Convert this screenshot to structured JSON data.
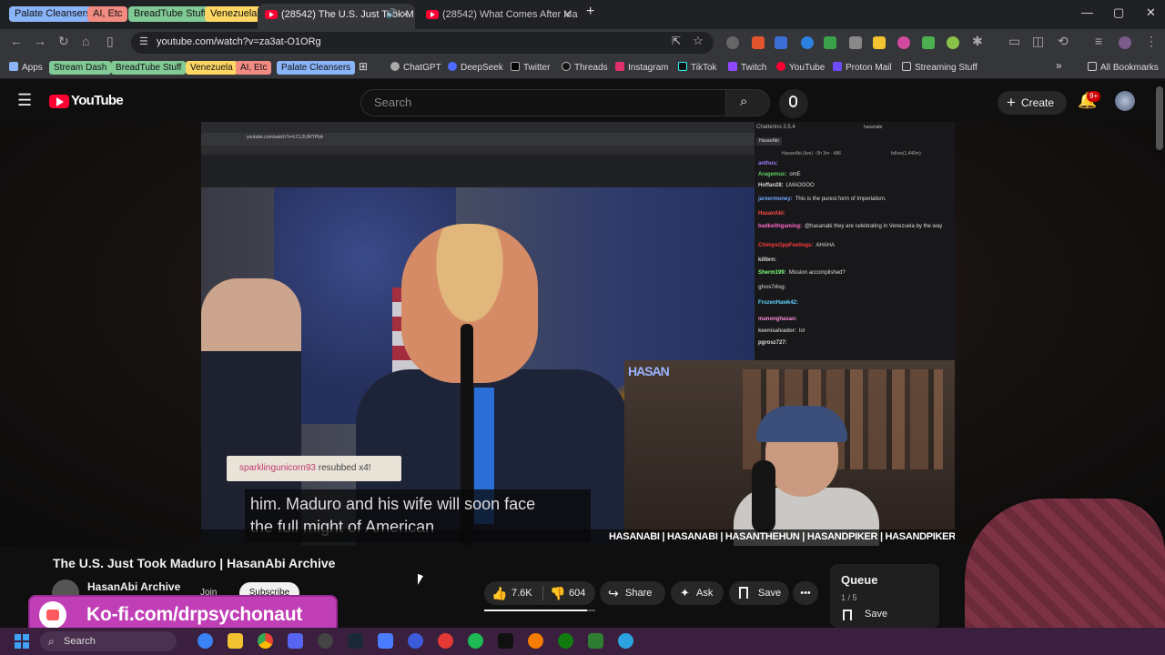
{
  "browser": {
    "tab_groups": [
      {
        "label": "Palate Cleansers",
        "color": "#8ab4f8"
      },
      {
        "label": "AI, Etc",
        "color": "#f28b82"
      },
      {
        "label": "BreadTube Stuff",
        "color": "#81c995"
      },
      {
        "label": "Venezuela",
        "color": "#fdd663"
      }
    ],
    "tabs": [
      {
        "title": "(28542) The U.S. Just Took M",
        "active": true
      },
      {
        "title": "(28542) What Comes After Mad",
        "active": false
      }
    ],
    "url": "youtube.com/watch?v=za3at-O1ORg",
    "bookmarks": {
      "apps": "Apps",
      "groups": [
        {
          "label": "Stream Dash",
          "color": "#81c995"
        },
        {
          "label": "BreadTube Stuff",
          "color": "#81c995"
        },
        {
          "label": "Venezuela",
          "color": "#fdd663"
        },
        {
          "label": "AI, Etc",
          "color": "#f28b82"
        },
        {
          "label": "Palate Cleansers",
          "color": "#8ab4f8"
        }
      ],
      "items": [
        "ChatGPT",
        "DeepSeek",
        "Twitter",
        "Threads",
        "Instagram",
        "TikTok",
        "Twitch",
        "YouTube",
        "Proton Mail",
        "Streaming Stuff"
      ],
      "all": "All Bookmarks"
    }
  },
  "youtube": {
    "logo": "YouTube",
    "search_placeholder": "Search",
    "create": "Create",
    "notifications": "9+"
  },
  "video": {
    "frame_url": "youtube.com/watch?v=LCL2UWTPbA",
    "chat_title": "Chatterino 2.5.4",
    "chat_tab": "HasanAbi",
    "chat_channel": "hasanabi",
    "chat_status": "HasanAbi (live) - 0h 3m - 486",
    "chat_follow": "follow(1,440m)",
    "chat": [
      {
        "user": "anthus:",
        "text": "",
        "color": "#9e7bff"
      },
      {
        "user": "Aragemus:",
        "text": "omE",
        "color": "#5fd35f"
      },
      {
        "user": "Hoffan28:",
        "text": "LMAOOOO",
        "color": "#ddd"
      },
      {
        "user": "jareermoney:",
        "text": "This is the purest form of Imperialism.",
        "color": "#6fa8ff"
      },
      {
        "user": "HasanAbi:",
        "text": "",
        "color": "#ff4a4a"
      },
      {
        "user": "badkeithgaming:",
        "text": "@hasanabi they are celebrating in Venezuela by the way",
        "color": "#ff66cc"
      },
      {
        "user": "ChimpsOppFeelings:",
        "text": "AHAHA",
        "color": "#ff3b3b"
      },
      {
        "user": "killbrn:",
        "text": "",
        "color": "#ddd"
      },
      {
        "user": "Sherm199:",
        "text": "Mission accomplished?",
        "color": "#7cff7c"
      },
      {
        "user": "ghos7dog:",
        "text": "",
        "color": "#aaa"
      },
      {
        "user": "FrozenHawk42:",
        "text": "",
        "color": "#5fd3ff"
      },
      {
        "user": "manonghasan:",
        "text": "",
        "color": "#ff8ad8"
      },
      {
        "user": "keenisalvador:",
        "text": "lol",
        "color": "#bbb"
      },
      {
        "user": "pgrosz727:",
        "text": "",
        "color": "#ddd"
      }
    ],
    "resub_user": "sparklingunicorn93",
    "resub_text": "resubbed x4!",
    "caption_line1": "him. Maduro and his wife will soon face",
    "caption_line2": "the full might of American",
    "cam_logo": "HASAN",
    "social_handles": "HASANABI | HASANABI | HASANTHEHUN | HASANDPIKER | HASANDPIKER"
  },
  "meta": {
    "title": "The U.S. Just Took Maduro | HasanAbi Archive",
    "channel": "HasanAbi Archive",
    "join": "Join",
    "subscribe": "Subscribe",
    "likes": "7.6K",
    "dislikes": "604",
    "share": "Share",
    "ask": "Ask",
    "save": "Save",
    "like_ratio": 0.93
  },
  "queue": {
    "title": "Queue",
    "count": "1 / 5",
    "save": "Save"
  },
  "overlay": {
    "kofi": "Ko-fi.com/drpsychonaut"
  },
  "taskbar": {
    "search": "Search"
  }
}
